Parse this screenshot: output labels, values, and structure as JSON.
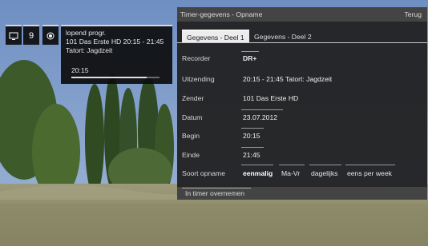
{
  "channel": {
    "number": "9"
  },
  "info": {
    "status": "lopend progr.",
    "program_line": "101 Das Erste HD 20:15 - 21:45",
    "program_title": "Tatort: Jagdzeit",
    "time": "20:15",
    "progress": 0.85
  },
  "panel": {
    "title": "Timer-gegevens - Opname",
    "back_label": "Terug",
    "tabs": [
      {
        "label": "Gegevens - Deel 1",
        "active": true
      },
      {
        "label": "Gegevens - Deel 2",
        "active": false
      }
    ],
    "rows": [
      {
        "label": "Recorder",
        "value": "DR+"
      },
      {
        "label": "Uitzending",
        "value": "20:15 - 21:45 Tatort: Jagdzeit"
      },
      {
        "label": "Zender",
        "value": "101 Das Erste HD"
      },
      {
        "label": "Datum",
        "value": "23.07.2012"
      },
      {
        "label": "Begin",
        "value": "20:15"
      },
      {
        "label": "Einde",
        "value": "21:45"
      },
      {
        "label": "Soort opname"
      }
    ],
    "record_type_options": [
      "eenmalig",
      "Ma-Vr",
      "dagelijks",
      "eens per week"
    ],
    "record_type_selected": "eenmalig",
    "footer_button": "In timer overnemen"
  },
  "icons": {
    "tv": "tv-icon",
    "record": "record-icon"
  }
}
